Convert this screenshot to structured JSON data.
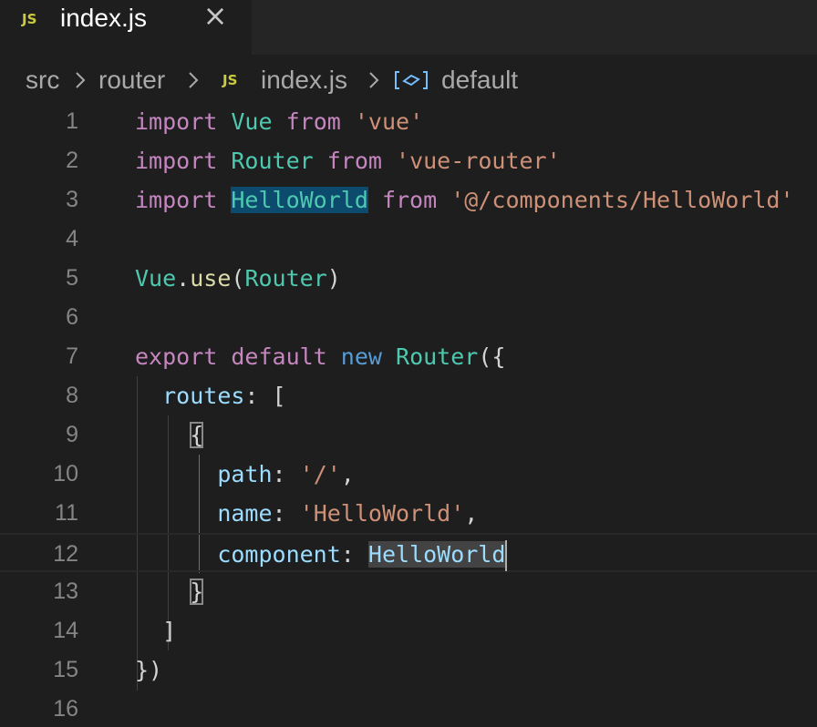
{
  "tab": {
    "icon_text": "JS",
    "label": "index.js",
    "close_glyph": "×"
  },
  "breadcrumb": {
    "items": [
      "src",
      "router",
      "index.js",
      "default"
    ],
    "file_icon_text": "JS",
    "symbol_icon": "variable-symbol-icon"
  },
  "editor": {
    "line_numbers": [
      "1",
      "2",
      "3",
      "4",
      "5",
      "6",
      "7",
      "8",
      "9",
      "10",
      "11",
      "12",
      "13",
      "14",
      "15",
      "16"
    ],
    "current_line": "12",
    "lines": [
      [
        {
          "t": "import",
          "c": "kw"
        },
        {
          "t": " "
        },
        {
          "t": "Vue",
          "c": "cls"
        },
        {
          "t": " "
        },
        {
          "t": "from",
          "c": "kw"
        },
        {
          "t": " "
        },
        {
          "t": "'vue'",
          "c": "str"
        }
      ],
      [
        {
          "t": "import",
          "c": "kw"
        },
        {
          "t": " "
        },
        {
          "t": "Router",
          "c": "cls"
        },
        {
          "t": " "
        },
        {
          "t": "from",
          "c": "kw"
        },
        {
          "t": " "
        },
        {
          "t": "'vue-router'",
          "c": "str"
        }
      ],
      [
        {
          "t": "import",
          "c": "kw"
        },
        {
          "t": " "
        },
        {
          "t": "HelloWorld",
          "c": "cls hl-sel"
        },
        {
          "t": " "
        },
        {
          "t": "from",
          "c": "kw"
        },
        {
          "t": " "
        },
        {
          "t": "'@/components/HelloWorld'",
          "c": "str"
        }
      ],
      [],
      [
        {
          "t": "Vue",
          "c": "cls"
        },
        {
          "t": "."
        },
        {
          "t": "use",
          "c": "fn"
        },
        {
          "t": "("
        },
        {
          "t": "Router",
          "c": "cls"
        },
        {
          "t": ")"
        }
      ],
      [],
      [
        {
          "t": "export",
          "c": "kw"
        },
        {
          "t": " "
        },
        {
          "t": "default",
          "c": "kw"
        },
        {
          "t": " "
        },
        {
          "t": "new",
          "c": "blu"
        },
        {
          "t": " "
        },
        {
          "t": "Router",
          "c": "cls"
        },
        {
          "t": "({"
        }
      ],
      [
        {
          "t": "  "
        },
        {
          "t": "routes",
          "c": "prp"
        },
        {
          "t": ": ["
        }
      ],
      [
        {
          "t": "    "
        },
        {
          "t": "{",
          "c": "bracket-box"
        }
      ],
      [
        {
          "t": "      "
        },
        {
          "t": "path",
          "c": "prp"
        },
        {
          "t": ": "
        },
        {
          "t": "'/'",
          "c": "str"
        },
        {
          "t": ","
        }
      ],
      [
        {
          "t": "      "
        },
        {
          "t": "name",
          "c": "prp"
        },
        {
          "t": ": "
        },
        {
          "t": "'HelloWorld'",
          "c": "str"
        },
        {
          "t": ","
        }
      ],
      [
        {
          "t": "      "
        },
        {
          "t": "component",
          "c": "prp"
        },
        {
          "t": ": "
        },
        {
          "t": "HelloWorld",
          "c": "prp hl-word"
        },
        {
          "t": "|",
          "c": "cursor"
        }
      ],
      [
        {
          "t": "    "
        },
        {
          "t": "}",
          "c": "bracket-box"
        }
      ],
      [
        {
          "t": "  "
        },
        {
          "t": "]"
        }
      ],
      [
        {
          "t": "})"
        }
      ],
      []
    ]
  },
  "colors": {
    "background": "#1e1e1e",
    "tab_bar": "#252526",
    "keyword": "#c586c0",
    "class": "#4ec9b0",
    "string": "#ce9178",
    "property": "#9cdcfe",
    "function": "#dcdcaa",
    "js_icon": "#cbcb41"
  }
}
